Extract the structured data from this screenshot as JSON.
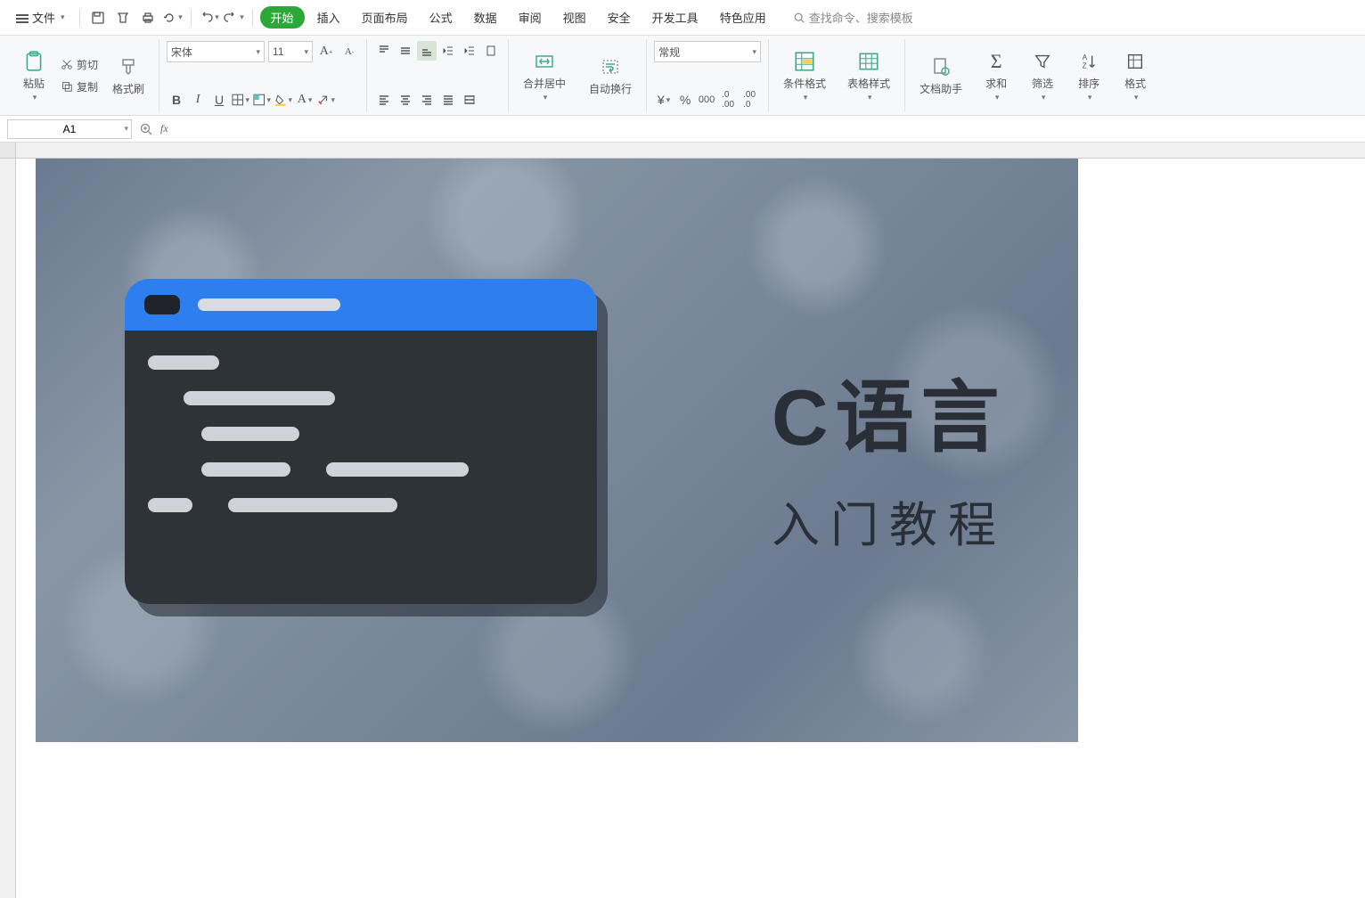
{
  "menubar": {
    "file": "文件",
    "tabs": [
      "开始",
      "插入",
      "页面布局",
      "公式",
      "数据",
      "审阅",
      "视图",
      "安全",
      "开发工具",
      "特色应用"
    ],
    "search_placeholder": "查找命令、搜索模板"
  },
  "ribbon": {
    "clipboard": {
      "paste": "粘贴",
      "cut": "剪切",
      "copy": "复制",
      "format_painter": "格式刷"
    },
    "font": {
      "name": "宋体",
      "size": "11"
    },
    "alignment": {
      "merge_center": "合并居中",
      "wrap_text": "自动换行"
    },
    "number": {
      "format": "常规"
    },
    "styles": {
      "conditional": "条件格式",
      "table_style": "表格样式"
    },
    "tools": {
      "doc_helper": "文档助手",
      "sum": "求和",
      "filter": "筛选",
      "sort": "排序",
      "format": "格式"
    }
  },
  "formula_bar": {
    "cell_ref": "A1"
  },
  "image": {
    "heading1": "C语言",
    "heading2": "入门教程"
  }
}
